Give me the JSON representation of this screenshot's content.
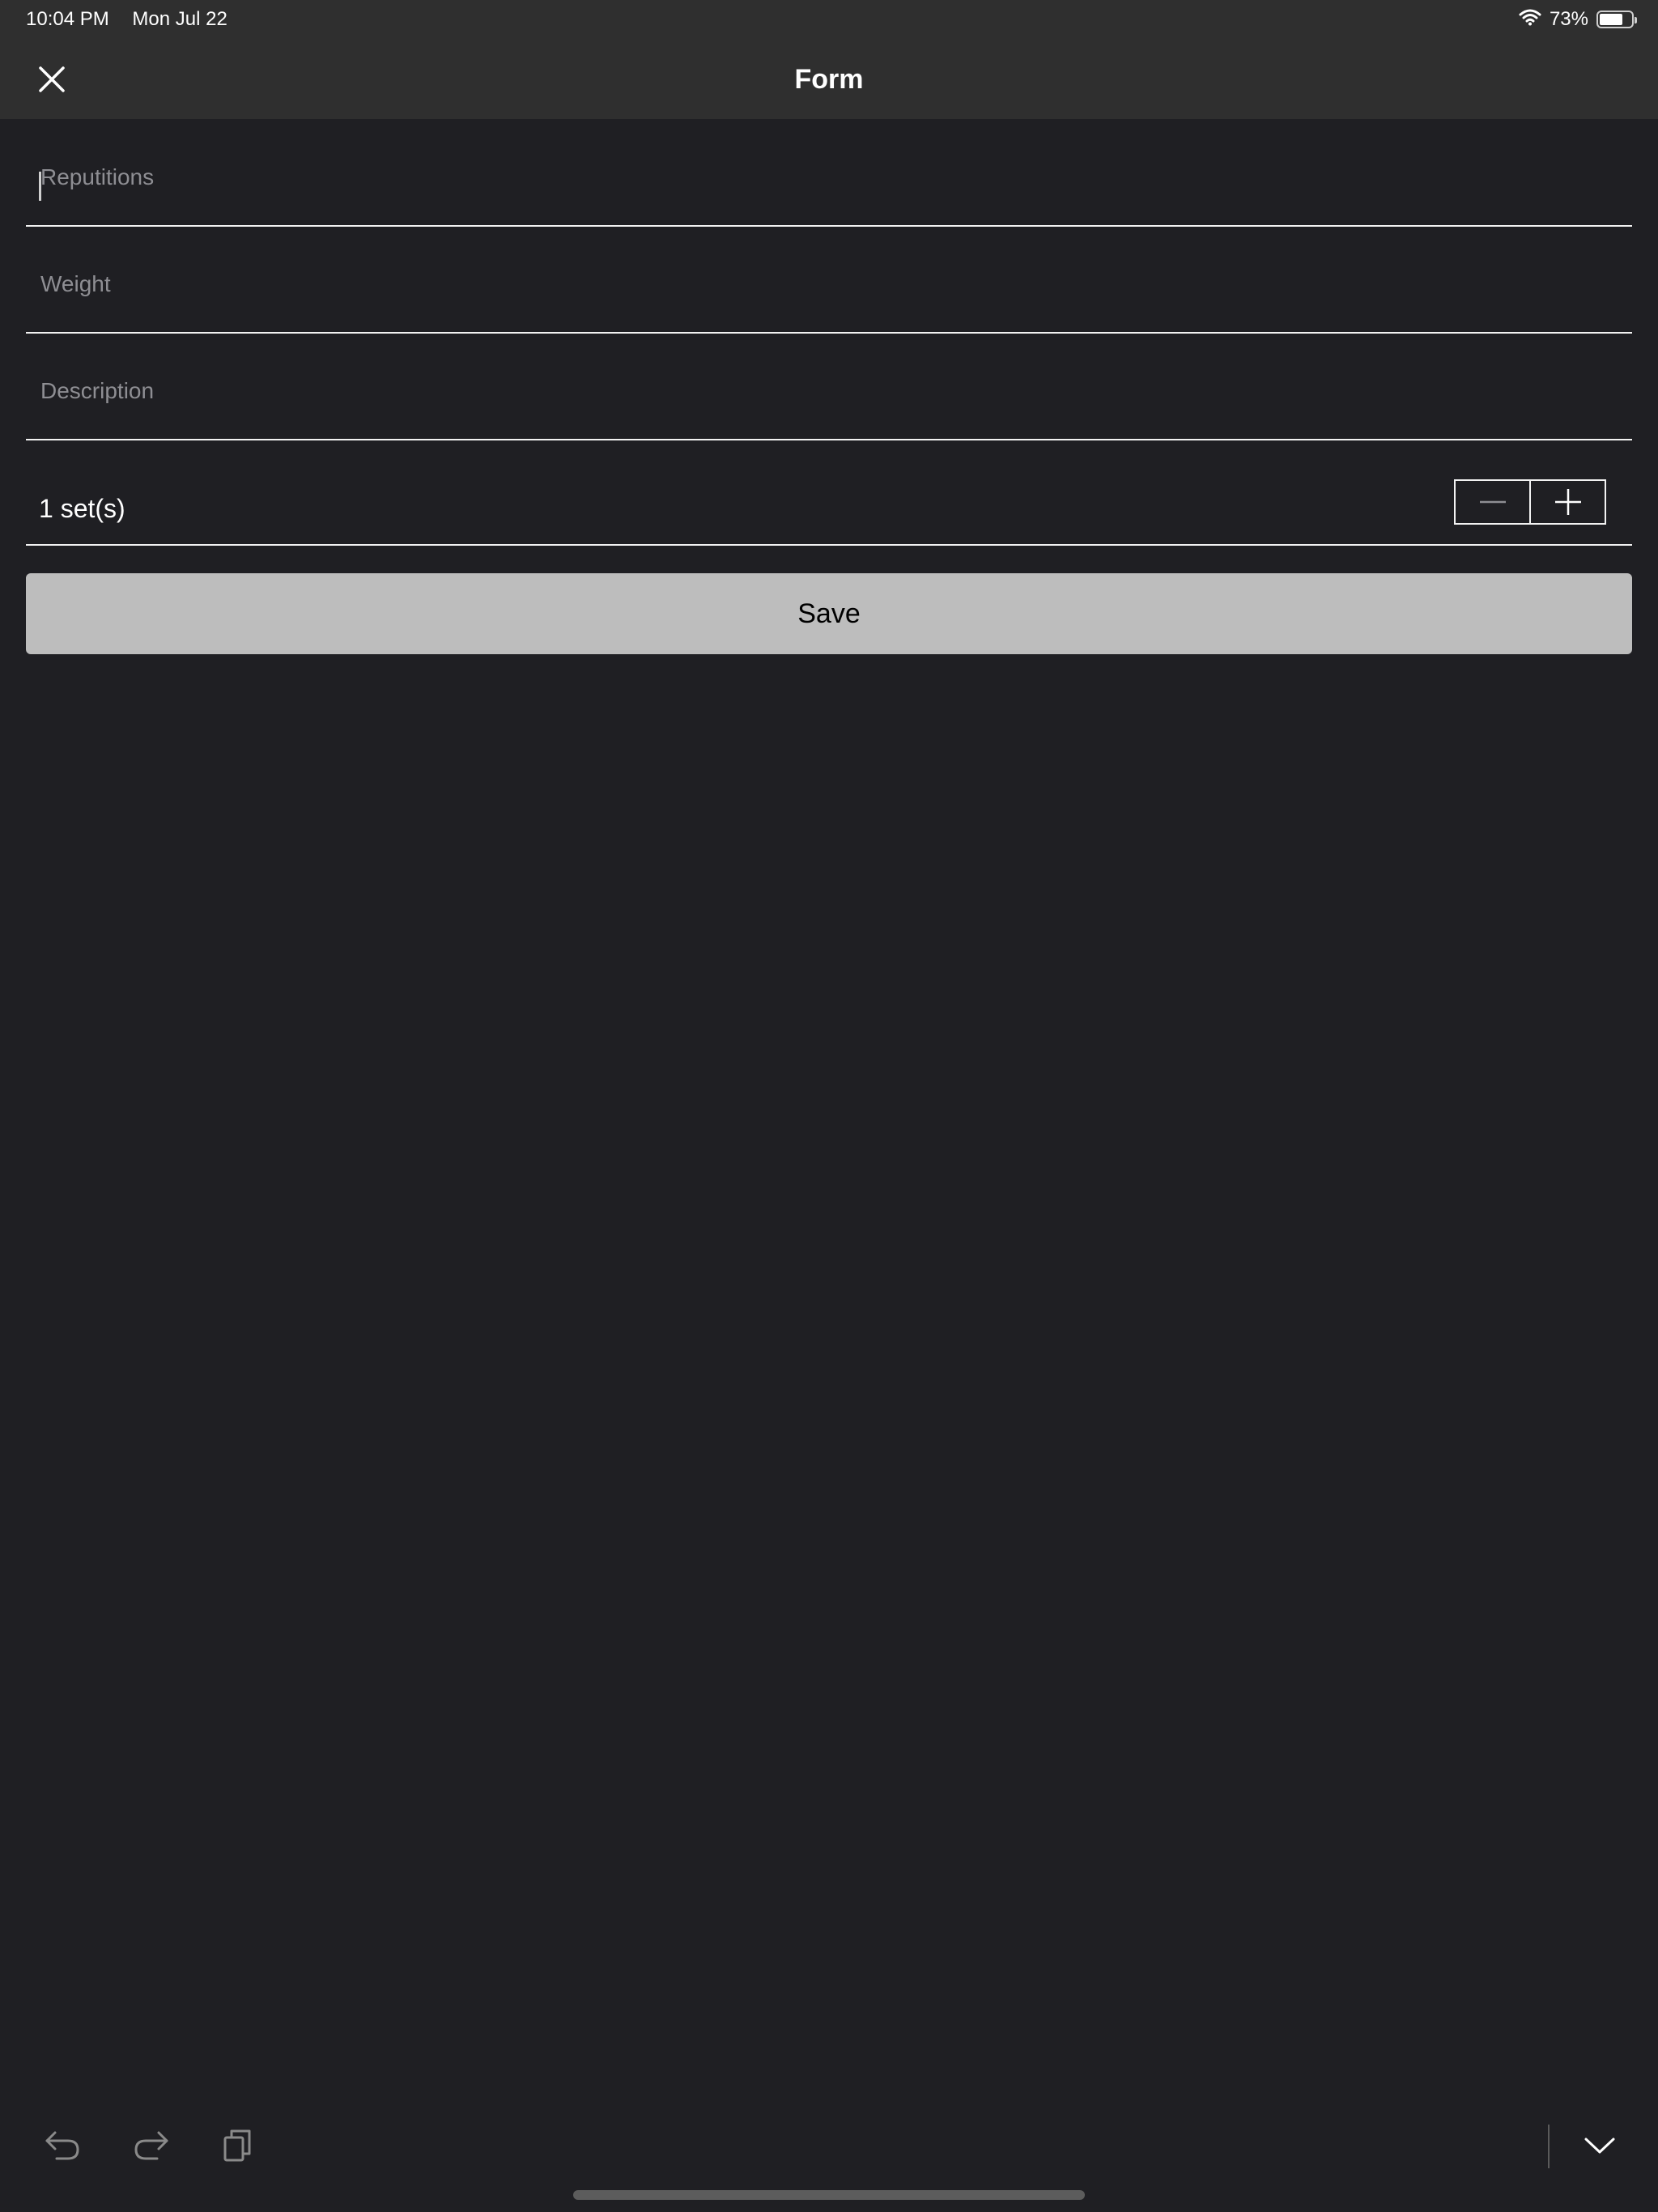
{
  "status_bar": {
    "time": "10:04 PM",
    "date": "Mon Jul 22",
    "battery_percent": "73%",
    "battery_level": 0.73,
    "wifi_icon": "wifi-icon"
  },
  "header": {
    "title": "Form",
    "close_icon": "close-icon"
  },
  "form": {
    "repetitions": {
      "value": "",
      "placeholder": "Reputitions"
    },
    "weight": {
      "value": "",
      "placeholder": "Weight"
    },
    "description": {
      "value": "",
      "placeholder": "Description"
    },
    "sets_label": "1 set(s)",
    "stepper": {
      "decrement_icon": "minus-icon",
      "increment_icon": "plus-icon"
    },
    "save_label": "Save"
  },
  "toolbar": {
    "undo_icon": "undo-icon",
    "redo_icon": "redo-icon",
    "paste_icon": "paste-icon",
    "dismiss_keyboard_icon": "chevron-down-icon"
  },
  "colors": {
    "background": "#1f1f23",
    "header": "#2f2f2f",
    "save_button": "#bdbdbd",
    "placeholder": "#8e8e93"
  }
}
